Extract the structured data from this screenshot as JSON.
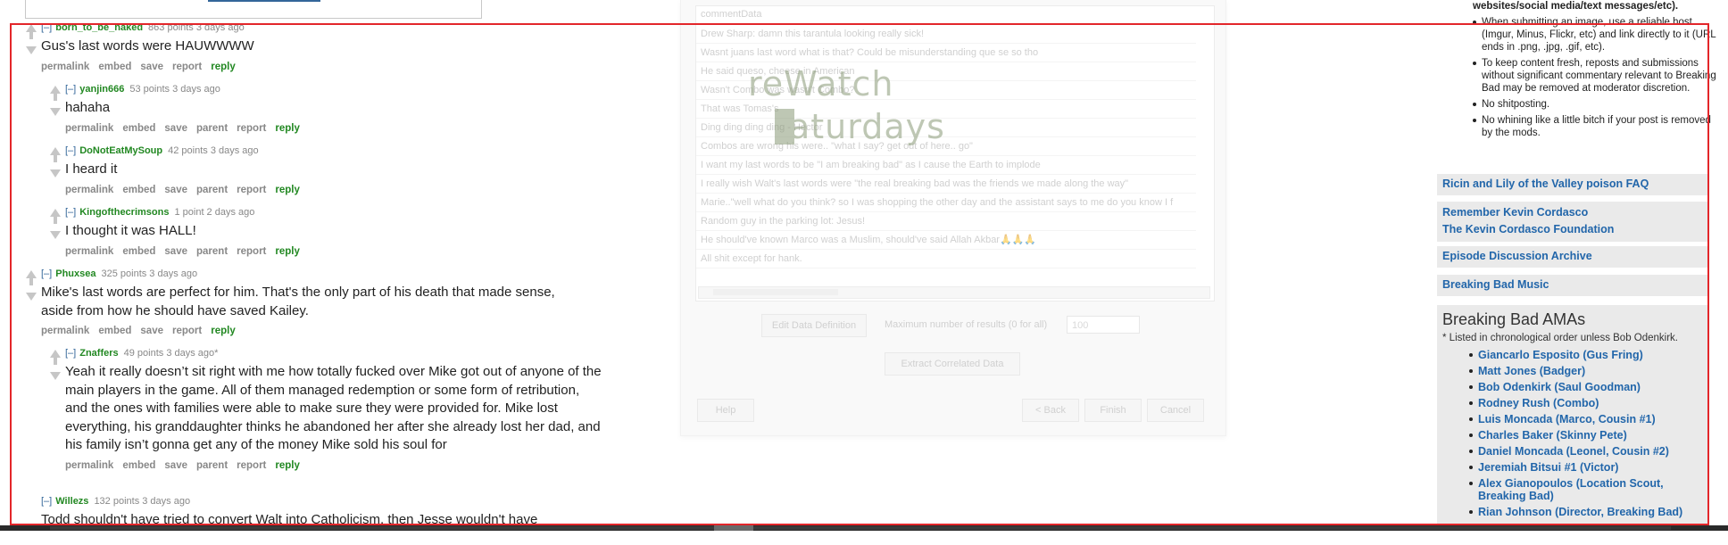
{
  "comments": [
    {
      "collapse": "[–]",
      "author": "born_to_be_naked",
      "meta": "863 points 3 days ago",
      "body": "Gus's last words were HAUWWWW",
      "buttons": [
        "permalink",
        "embed",
        "save",
        "report"
      ],
      "reply": "reply"
    },
    {
      "collapse": "[–]",
      "author": "yanjin666",
      "meta": "53 points 3 days ago",
      "body": "hahaha",
      "buttons": [
        "permalink",
        "embed",
        "save",
        "parent",
        "report"
      ],
      "reply": "reply"
    },
    {
      "collapse": "[–]",
      "author": "DoNotEatMySoup",
      "meta": "42 points 3 days ago",
      "body": "I heard it",
      "buttons": [
        "permalink",
        "embed",
        "save",
        "parent",
        "report"
      ],
      "reply": "reply"
    },
    {
      "collapse": "[–]",
      "author": "Kingofthecrimsons",
      "meta": "1 point 2 days ago",
      "body": "I thought it was HALL!",
      "buttons": [
        "permalink",
        "embed",
        "save",
        "parent",
        "report"
      ],
      "reply": "reply"
    },
    {
      "collapse": "[–]",
      "author": "Phuxsea",
      "meta": "325 points 3 days ago",
      "body": "Mike's last words are perfect for him. That's the only part of his death that made sense, aside from how he should have saved Kailey.",
      "buttons": [
        "permalink",
        "embed",
        "save",
        "report"
      ],
      "reply": "reply"
    },
    {
      "collapse": "[–]",
      "author": "Znaffers",
      "meta": "49 points 3 days ago*",
      "body": "Yeah it really doesn’t sit right with me how totally fucked over Mike got out of anyone of the main players in the game. All of them managed redemption or some form of retribution, and the ones with families were able to make sure they were provided for. Mike lost everything, his granddaughter thinks he abandoned her after she already lost her dad, and his family isn’t gonna get any of the money Mike sold his soul for",
      "buttons": [
        "permalink",
        "embed",
        "save",
        "parent",
        "report"
      ],
      "reply": "reply"
    },
    {
      "collapse": "[–]",
      "author": "Willezs",
      "meta": "132 points 3 days ago",
      "body": "Todd shouldn't have tried to convert Walt into Catholicism, then Jesse wouldn't have"
    }
  ],
  "dialog": {
    "table_header": "commentData",
    "rows": [
      "Drew Sharp: damn this tarantula looking really sick!",
      "Wasnt juans last word what is that? Could be misunderstanding que se so tho",
      "He said queso, cheese in American",
      "Wasn't Combo was wasn't Combo?",
      "That was Tomas's",
      "Ding ding ding ding - Hector",
      "Combos are wrong his were.. \"what I say? get out of here.. go\"",
      "I want my last words to be \"I am breaking bad\" as I cause the Earth to implode",
      "I really wish Walt's last words were \"the real breaking bad was the friends we made along the way\"",
      "Marie..\"well what do you think? so I was shopping the other day and the assistant says to me do you know I f",
      "Random guy in the parking lot: Jesus!",
      "He should've known Marco was a Muslim, should've said Allah Akbar🙏🙏🙏",
      "All shit except for hank."
    ],
    "edit_button": "Edit Data Definition",
    "max_label": "Maximum number of results (0 for all)",
    "max_value": "100",
    "extract_button": "Extract Correlated Data",
    "help_button": "Help",
    "back_button": "< Back",
    "finish_button": "Finish",
    "cancel_button": "Cancel"
  },
  "logo": {
    "line1": "reWatch",
    "line2": "aturdays"
  },
  "sidebar": {
    "rules_cont": "websites/social media/text messages/etc).",
    "rules": [
      "When submitting an image, use a reliable host (Imgur, Minus, Flickr, etc) and link directly to it (URL ends in .png, .jpg, .gif, etc).",
      "To keep content fresh, reposts and submissions without significant commentary relevant to Breaking Bad may be removed at moderator discretion.",
      "No shitposting.",
      "No whining like a little bitch if your post is removed by the mods."
    ],
    "links": {
      "ricin": "Ricin and Lily of the Valley poison FAQ",
      "kevin": "Remember Kevin Cordasco",
      "foundation": "The Kevin Cordasco Foundation",
      "archive": "Episode Discussion Archive",
      "music": "Breaking Bad Music"
    },
    "ama_title": "Breaking Bad AMAs",
    "ama_note": "* Listed in chronological order unless Bob Odenkirk.",
    "amas": [
      "Giancarlo Esposito (Gus Fring)",
      "Matt Jones (Badger)",
      "Bob Odenkirk (Saul Goodman)",
      "Rodney Rush (Combo)",
      "Luis Moncada (Marco, Cousin #1)",
      "Charles Baker (Skinny Pete)",
      "Daniel Moncada (Leonel, Cousin #2)",
      "Jeremiah Bitsui #1 (Victor)",
      "Alex Gianopoulos (Location Scout, Breaking Bad)",
      "Rian Johnson (Director, Breaking Bad)"
    ]
  }
}
